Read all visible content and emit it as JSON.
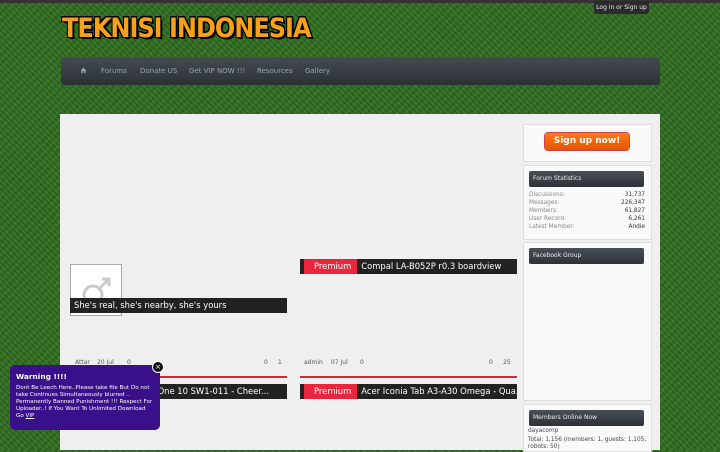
{
  "header": {
    "login_label": "Log in or Sign up",
    "logo_text": "TEKNISI INDONESIA"
  },
  "nav": {
    "items": [
      "Forums",
      "Donate US",
      "Get VIP NOW !!!",
      "Resources",
      "Gallery"
    ]
  },
  "sidebar": {
    "signup_label": "Sign up now!",
    "stats_title": "Forum Statistics",
    "stats": [
      {
        "k": "Discussions:",
        "v": "31,737"
      },
      {
        "k": "Messages:",
        "v": "226,347"
      },
      {
        "k": "Members:",
        "v": "61,827"
      },
      {
        "k": "User Record:",
        "v": "6,261"
      },
      {
        "k": "Latest Member:",
        "v": "Andie"
      }
    ],
    "facebook_title": "Facebook Group",
    "members_title": "Members Online Now",
    "member_name": "dayacomp",
    "total_line1": "Total: 1,156 (members: 1, guests: 1,105,",
    "total_line2": "robots: 50)"
  },
  "threads": [
    {
      "caption": "She's real, she's nearby, she's yours",
      "premium": "",
      "author": "Attar",
      "date": "20 Jul",
      "views": "0",
      "replies": "0",
      "likes": "1"
    },
    {
      "caption": "Compal LA-B052P r0.3 boardview",
      "premium": "Premium",
      "author": "admin",
      "date": "07 Jul",
      "views": "0",
      "replies": "0",
      "likes": "25"
    },
    {
      "caption": "ch One 10 SW1-011 - Cheer...",
      "premium": ""
    },
    {
      "caption": "Acer Iconia Tab A3-A30 Omega - Qua...",
      "premium": "Premium"
    }
  ],
  "warning": {
    "title": "Warning !!!!",
    "message": "Dont Be Leech Here..Please take file But Do not take Continues Simultaneously blurred .. Permanently Banned Punishment !!! Respect For Uploader..! If You Want To Unlimited Download Go",
    "link": "VIP",
    "close": "×"
  },
  "colors": {
    "accent": "#e8273c",
    "signup": "#ff6a00",
    "warning_bg": "#3a0f8a"
  }
}
